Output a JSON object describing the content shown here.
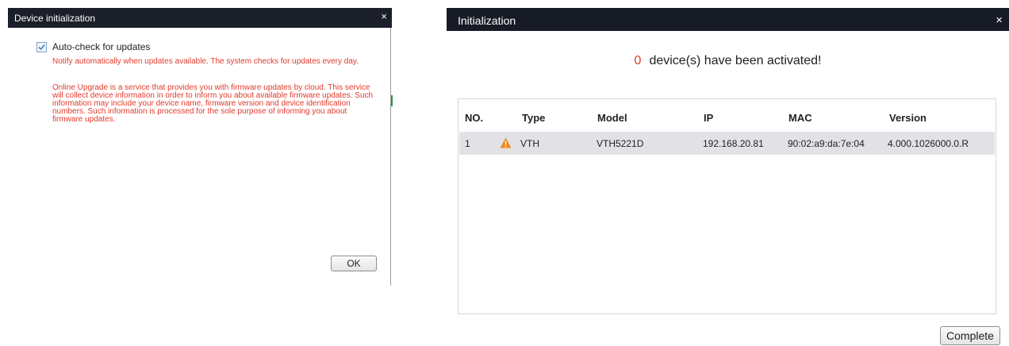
{
  "device_init_dialog": {
    "title": "Device initialization",
    "close_glyph": "×",
    "auto_check": {
      "label": "Auto-check for updates",
      "checked": true
    },
    "notice_1": "Notify automatically when updates available. The system checks for updates every day.",
    "notice_2": "Online Upgrade is a service that provides you with firmware updates by cloud. This service will collect device information in order to inform you about available firmware updates. Such information may include your device name, firmware version and device identification numbers. Such information is processed for the sole purpose of informing you about firmware updates.",
    "ok_label": "OK"
  },
  "initialization_dialog": {
    "title": "Initialization",
    "close_glyph": "×",
    "activated_count": "0",
    "activated_text": "device(s) have been activated!",
    "columns": [
      "NO.",
      "Type",
      "Model",
      "IP",
      "MAC",
      "Version"
    ],
    "rows": [
      {
        "no": "1",
        "status_icon": "warning-icon",
        "type": "VTH",
        "model": "VTH5221D",
        "ip": "192.168.20.81",
        "mac": "90:02:a9:da:7e:04",
        "version": "4.000.1026000.0.R"
      }
    ],
    "complete_label": "Complete"
  },
  "colors": {
    "titlebar": "#1b1f2a",
    "notice_red": "#e23a2c",
    "row_highlight": "#e2e2e6",
    "warning_orange": "#f08a24"
  }
}
